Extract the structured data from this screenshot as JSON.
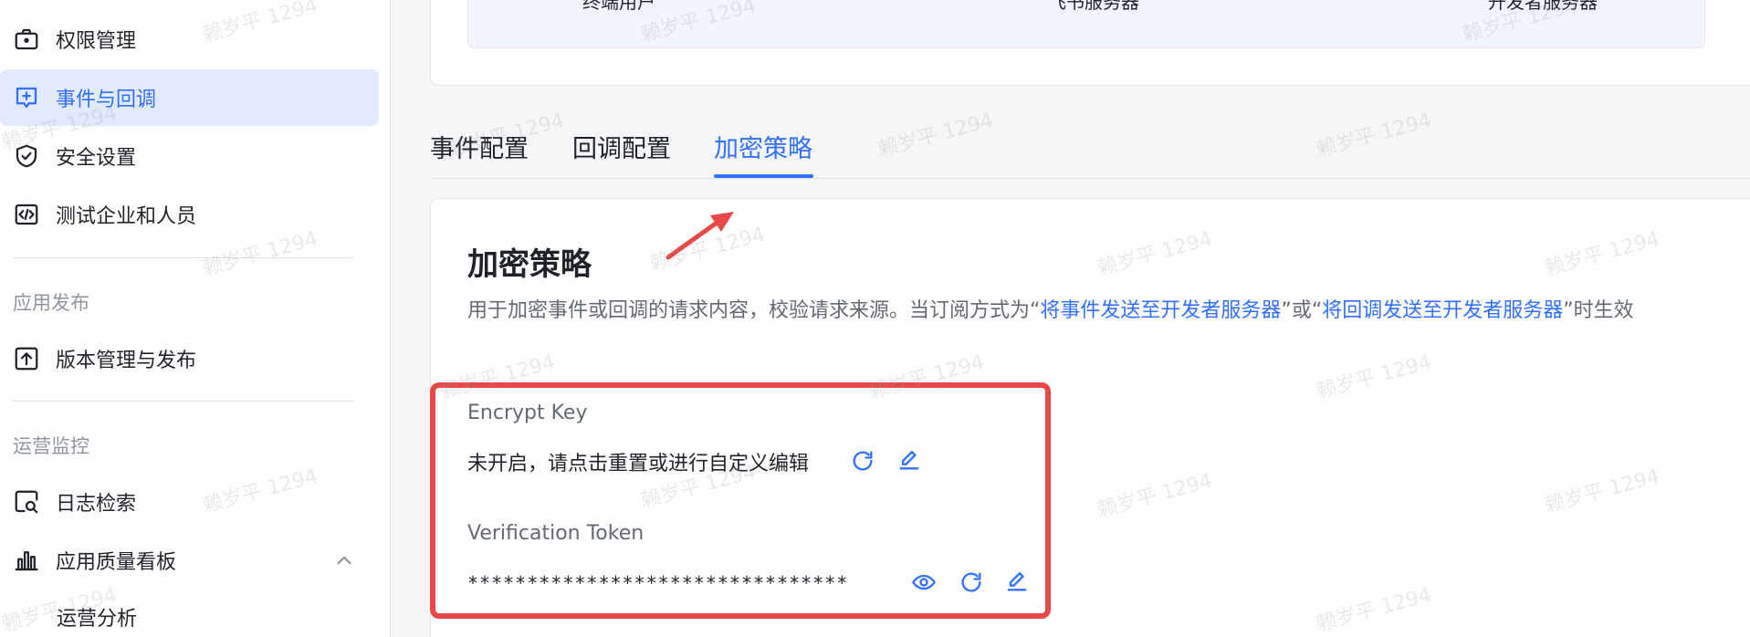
{
  "sidebar": {
    "items": [
      {
        "label": "权限管理",
        "icon": "briefcase-icon"
      },
      {
        "label": "事件与回调",
        "icon": "plus-square-icon"
      },
      {
        "label": "安全设置",
        "icon": "shield-check-icon"
      },
      {
        "label": "测试企业和人员",
        "icon": "code-icon"
      }
    ],
    "groups": [
      {
        "title": "应用发布",
        "items": [
          {
            "label": "版本管理与发布",
            "icon": "upload-icon"
          }
        ]
      },
      {
        "title": "运营监控",
        "items": [
          {
            "label": "日志检索",
            "icon": "search-log-icon"
          },
          {
            "label": "应用质量看板",
            "icon": "bar-chart-icon"
          }
        ]
      }
    ],
    "sub_item": "运营分析"
  },
  "top_card": {
    "cut_texts": [
      "终端用户",
      "飞书服务器",
      "开发者服务器"
    ]
  },
  "tabs": [
    {
      "label": "事件配置",
      "active": false
    },
    {
      "label": "回调配置",
      "active": false
    },
    {
      "label": "加密策略",
      "active": true
    }
  ],
  "section": {
    "title": "加密策略",
    "desc_prefix": "用于加密事件或回调的请求内容，校验请求来源。当订阅方式为“",
    "desc_link1": "将事件发送至开发者服务器",
    "desc_mid": "”或“",
    "desc_link2": "将回调发送至开发者服务器",
    "desc_suffix": "”时生效"
  },
  "encrypt_key": {
    "label": "Encrypt Key",
    "value": "未开启，请点击重置或进行自定义编辑"
  },
  "verification_token": {
    "label": "Verification Token",
    "value": "********************************"
  },
  "watermark": "赖岁平 1294",
  "colors": {
    "accent": "#3370ff",
    "active_bg": "#e1eaff",
    "highlight": "#e84848"
  }
}
